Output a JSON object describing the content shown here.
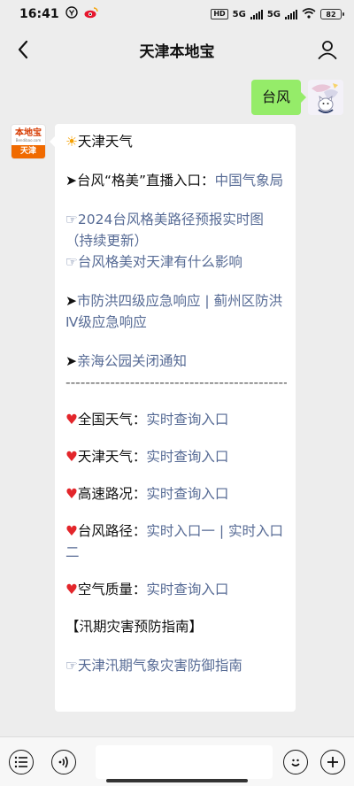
{
  "status_bar": {
    "time": "16:41",
    "network_left": "HD",
    "net1": "5G",
    "net2": "5G",
    "battery": "82"
  },
  "nav": {
    "title": "天津本地宝",
    "back_icon": "chevron-left-icon",
    "profile_icon": "person-icon"
  },
  "chat": {
    "user_message": "台风",
    "bot_avatar": {
      "name": "本地宝",
      "url": "Bendibao.com",
      "city": "天津"
    },
    "reply": {
      "weather_title": "天津天气",
      "typhoon_live_prefix": "➤台风“格美”直播入口：",
      "typhoon_live_link": "中国气象局",
      "typhoon_path_map": "☞2024台风格美路径预报实时图（持续更新）",
      "typhoon_impact": "☞台风格美对天津有什么影响",
      "flood_prefix": "➤",
      "flood_link": "市防洪四级应急响应 | 蓟州区防洪Ⅳ级应急响应",
      "park_prefix": "➤",
      "park_link": "亲海公园关闭通知",
      "divider": "-----------------------------------------------",
      "national_weather_label": "全国天气：",
      "national_weather_link": "实时查询入口",
      "tianjin_weather_label": "天津天气：",
      "tianjin_weather_link": "实时查询入口",
      "highway_label": "高速路况：",
      "highway_link": "实时查询入口",
      "typhoon_path_label": "台风路径：",
      "typhoon_path_link1": "实时入口一",
      "typhoon_path_sep": " | ",
      "typhoon_path_link2": "实时入口二",
      "air_quality_label": "空气质量：",
      "air_quality_link": "实时查询入口",
      "guide_heading": "【汛期灾害预防指南】",
      "guide_link_prefix": "☞",
      "guide_link": "天津汛期气象灾害防御指南"
    }
  },
  "input_bar": {
    "menu_icon": "list-menu-icon",
    "voice_icon": "voice-icon",
    "emoji_icon": "emoji-icon",
    "plus_icon": "plus-icon"
  }
}
